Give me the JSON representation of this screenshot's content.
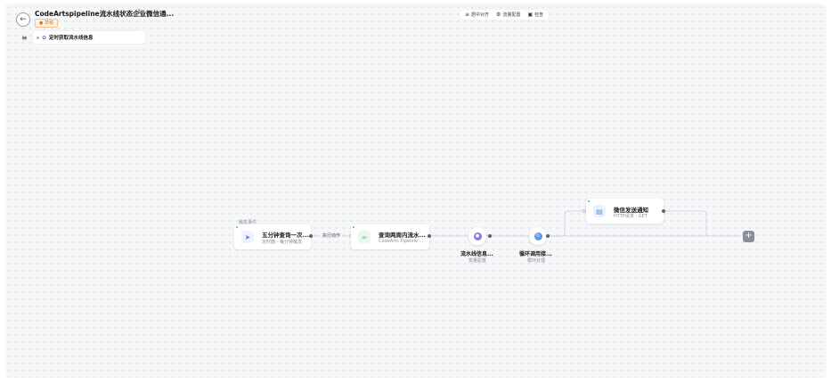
{
  "header": {
    "workflow_title": "CodeArtspipeline流水线状态企业微信通...",
    "status_badge": "● 草稿",
    "back_icon": "arrow-left-icon",
    "edit_icon": "pencil-icon"
  },
  "toolbar": {
    "items": [
      {
        "label": "居中对齐",
        "icon": "align-center-icon"
      },
      {
        "label": "流量配置",
        "icon": "gear-icon"
      },
      {
        "label": "检查",
        "icon": "check-doc-icon"
      }
    ]
  },
  "trigger_bar": {
    "label": "定时获取流水线信息"
  },
  "flow": {
    "trigger_event_label": "触发事件",
    "timer_node": {
      "title": "五分钟查询一次...",
      "subtitle": "定时器 - 每分钟触发"
    },
    "edge_label": "执行动作",
    "pipeline_node": {
      "title": "查询两周内流水...",
      "subtitle": "CodeArts Pipeline ..."
    },
    "variable_node": {
      "title": "流水线信息...",
      "subtitle": "变量配置"
    },
    "loop_node": {
      "title": "循环调用接...",
      "subtitle": "循环处理"
    },
    "http_node": {
      "title": "微信发送通知",
      "subtitle": "HTTP请求 - GET"
    },
    "add_label": "+"
  },
  "colors": {
    "accent": "#5e7ce0",
    "status_orange": "#e07a1f",
    "variable_purple": "#8a7ae6",
    "loop_blue": "#5e9ce0"
  }
}
